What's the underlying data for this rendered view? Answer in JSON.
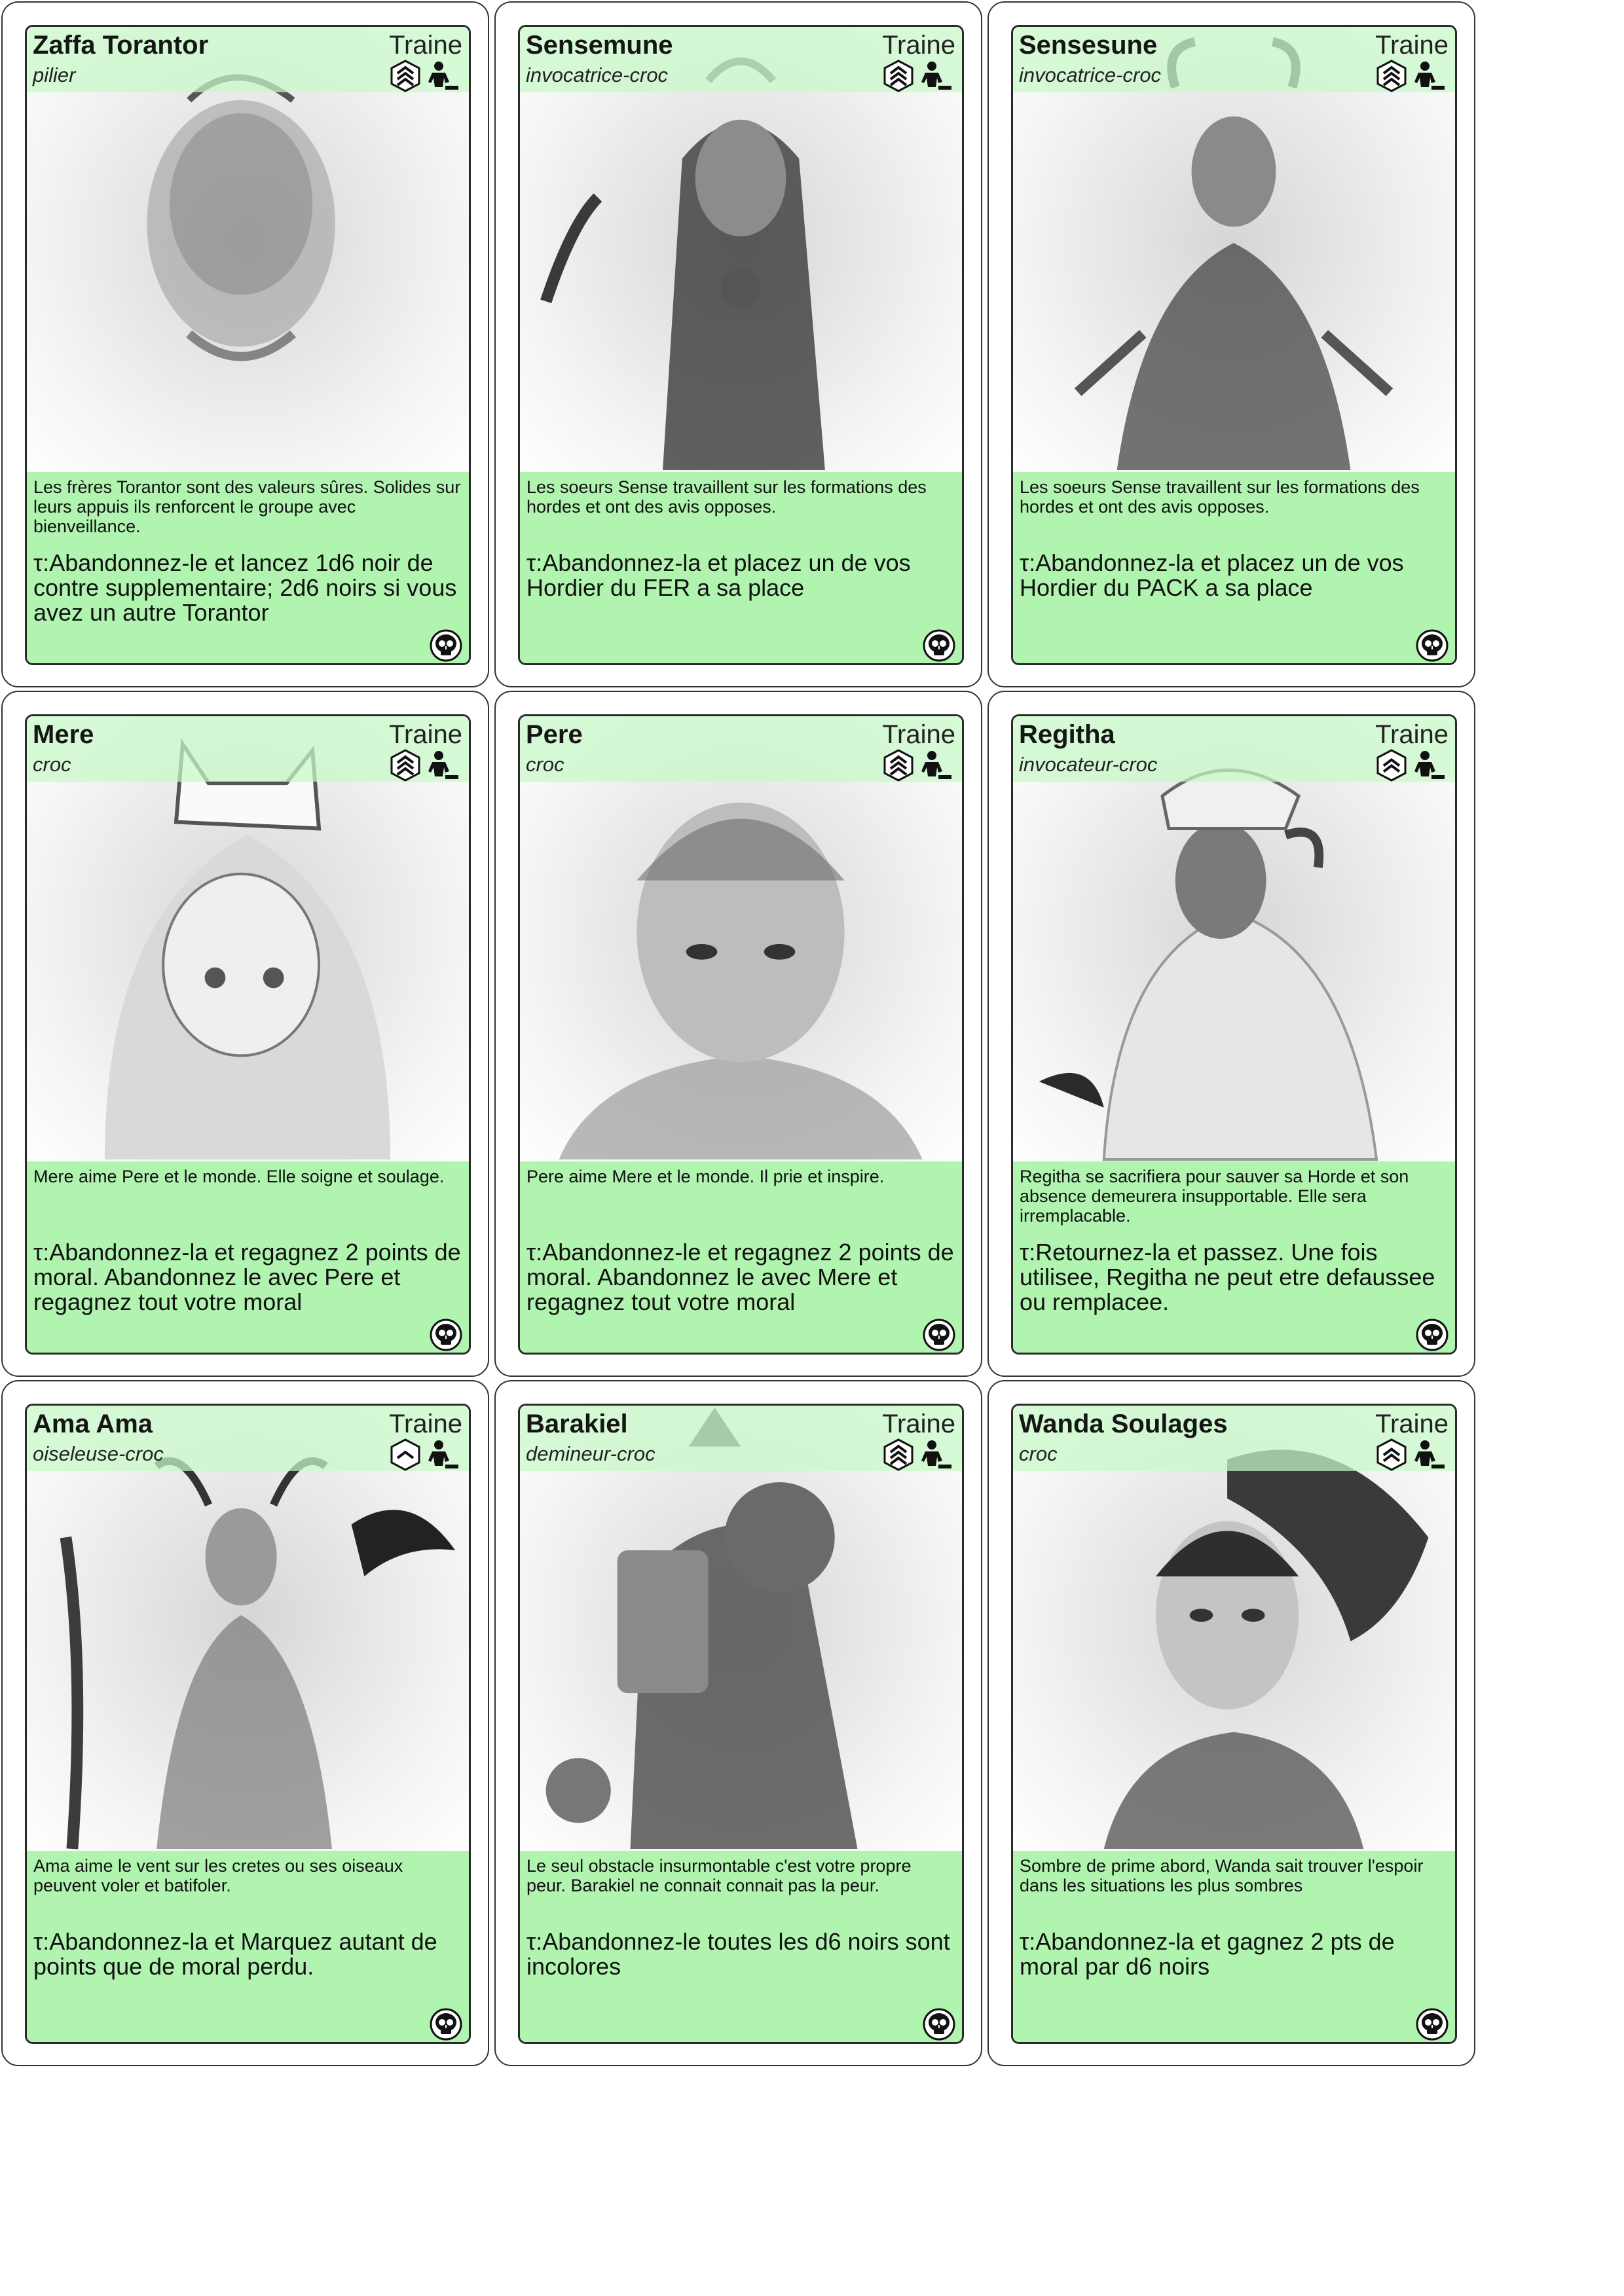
{
  "cards": [
    {
      "name": "Zaffa Torantor",
      "type": "Traine",
      "role": "pilier",
      "rank": 3,
      "flavor": "Les frères Torantor sont des valeurs sûres. Solides sur leurs appuis ils renforcent le groupe avec bienveillance.",
      "ability": "τ:Abandonnez-le et lancez 1d6 noir de contre supplementaire; 2d6 noirs si vous avez un autre Torantor"
    },
    {
      "name": "Sensemune",
      "type": "Traine",
      "role": "invocatrice-croc",
      "rank": 3,
      "flavor": "Les soeurs Sense travaillent sur les formations des hordes et ont des avis opposes.",
      "ability": "τ:Abandonnez-la et placez un de vos Hordier du FER a sa place"
    },
    {
      "name": "Sensesune",
      "type": "Traine",
      "role": "invocatrice-croc",
      "rank": 3,
      "flavor": "Les soeurs Sense travaillent sur les formations des hordes et ont des avis opposes.",
      "ability": "τ:Abandonnez-la et placez un de vos Hordier du PACK a sa place"
    },
    {
      "name": "Mere",
      "type": "Traine",
      "role": "croc",
      "rank": 3,
      "flavor": "Mere aime Pere et le monde. Elle soigne et soulage.",
      "ability": "τ:Abandonnez-la et regagnez 2 points de moral. Abandonnez le avec Pere et regagnez tout votre moral"
    },
    {
      "name": "Pere",
      "type": "Traine",
      "role": "croc",
      "rank": 3,
      "flavor": "Pere aime Mere et le monde. Il prie et inspire.",
      "ability": "τ:Abandonnez-le et regagnez 2 points de moral. Abandonnez le avec Mere et regagnez tout votre moral"
    },
    {
      "name": "Regitha",
      "type": "Traine",
      "role": "invocateur-croc",
      "rank": 2,
      "flavor": "Regitha se sacrifiera pour sauver sa Horde et son absence demeurera insupportable. Elle sera irremplacable.",
      "ability": "τ:Retournez-la et passez. Une fois utilisee, Regitha ne peut etre defaussee ou remplacee."
    },
    {
      "name": "Ama Ama",
      "type": "Traine",
      "role": "oiseleuse-croc",
      "rank": 1,
      "flavor": "Ama aime le vent sur les cretes ou ses oiseaux peuvent voler et batifoler.",
      "ability": "τ:Abandonnez-la et Marquez autant de points que de moral perdu."
    },
    {
      "name": "Barakiel",
      "type": "Traine",
      "role": "demineur-croc",
      "rank": 3,
      "flavor": "Le seul obstacle insurmontable c'est votre propre peur. Barakiel ne connait connait pas la peur.",
      "ability": "τ:Abandonnez-le toutes les d6 noirs sont incolores"
    },
    {
      "name": "Wanda Soulages",
      "type": "Traine",
      "role": "croc",
      "rank": 2,
      "flavor": "Sombre de prime abord, Wanda sait trouver l'espoir dans les situations les plus sombres",
      "ability": "τ:Abandonnez-la et gagnez 2 pts de moral par d6 noirs"
    }
  ],
  "icons": {
    "rank": "rank-chevron-icon",
    "gear": "worker-icon",
    "corner": "skull-icon"
  },
  "colors": {
    "header": "#c8f8c8",
    "text_panel": "#b0f4b0",
    "border": "#2a2a2a"
  }
}
